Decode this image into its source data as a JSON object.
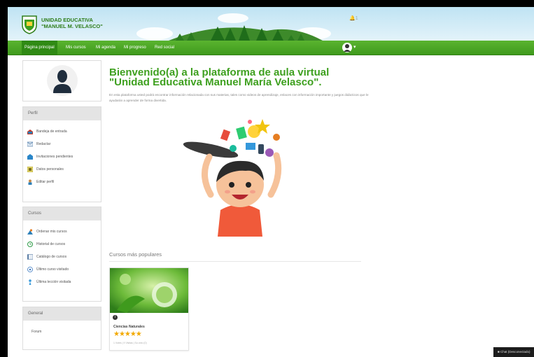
{
  "header": {
    "school_name_line1": "UNIDAD EDUCATIVA",
    "school_name_line2": "\"MANUEL M. VELASCO\"",
    "notification_count": "1"
  },
  "nav": {
    "items": [
      {
        "label": "Página principal",
        "active": true
      },
      {
        "label": "Mis cursos",
        "active": false
      },
      {
        "label": "Mi agenda",
        "active": false
      },
      {
        "label": "Mi progreso",
        "active": false
      },
      {
        "label": "Red social",
        "active": false
      }
    ],
    "user_caret": "▾"
  },
  "sidebar": {
    "perfil": {
      "title": "Perfil",
      "items": [
        {
          "label": "Bandeja de entrada",
          "icon": "inbox-icon"
        },
        {
          "label": "Redactar",
          "icon": "compose-icon"
        },
        {
          "label": "Invitaciones pendientes",
          "icon": "invitations-icon"
        },
        {
          "label": "Datos personales",
          "icon": "personal-data-icon"
        },
        {
          "label": "Editar perfil",
          "icon": "edit-profile-icon"
        }
      ]
    },
    "cursos": {
      "title": "Cursos",
      "items": [
        {
          "label": "Ordenar mis cursos",
          "icon": "sort-courses-icon"
        },
        {
          "label": "Historial de cursos",
          "icon": "history-icon"
        },
        {
          "label": "Catálogo de cursos",
          "icon": "catalog-icon"
        },
        {
          "label": "Último curso visitado",
          "icon": "last-course-icon"
        },
        {
          "label": "Última lección visitada",
          "icon": "last-lesson-icon"
        }
      ]
    },
    "general": {
      "title": "General",
      "items": [
        {
          "label": "Forum"
        }
      ]
    }
  },
  "main": {
    "welcome_line1": "Bienvenido(a) a la plataforma de aula virtual",
    "welcome_line2": "\"Unidad Educativa Manuel María Velasco\".",
    "intro_text": "En esta plataforma usted podrá encontrar información relacionada con sus materias, tales como videos de aprendizaje, enlaces con información importante y juegos didácticos que le ayudarán a aprender de forma divertida.",
    "popular_title": "Cursos más populares",
    "courses": [
      {
        "title": "Ciencias Naturales",
        "rating": 5,
        "stars": "★★★★★",
        "meta": "1 Votes | 9 Visitas | Su voto (0)"
      }
    ]
  },
  "chat": {
    "label": "Chat (Desconectado)"
  },
  "colors": {
    "brand_green": "#3ea01f",
    "nav_green": "#4aa824",
    "star": "#f2a900"
  }
}
